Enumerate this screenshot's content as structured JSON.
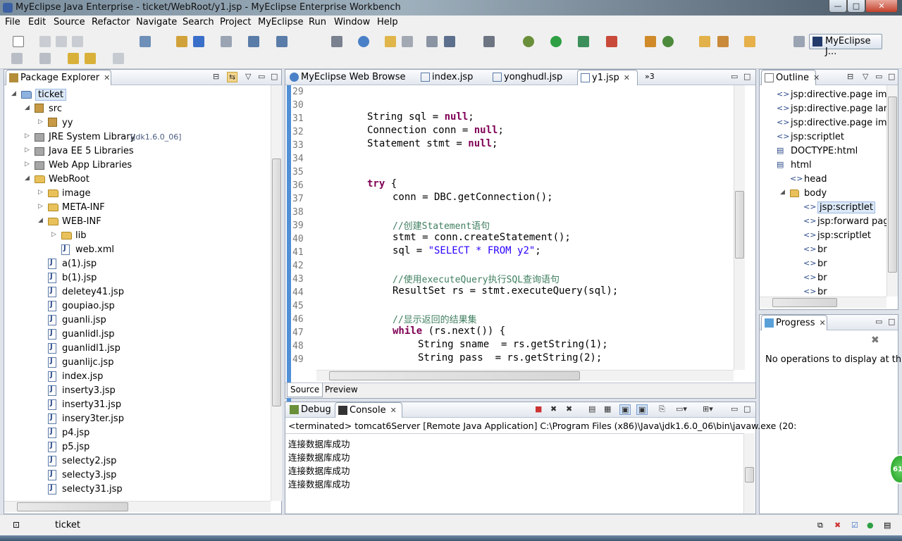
{
  "window": {
    "title": "MyEclipse Java Enterprise - ticket/WebRoot/y1.jsp - MyEclipse Enterprise Workbench",
    "min": "—",
    "max": "□",
    "close": "✕"
  },
  "menu": [
    "File",
    "Edit",
    "Source",
    "Refactor",
    "Navigate",
    "Search",
    "Project",
    "MyEclipse",
    "Run",
    "Window",
    "Help"
  ],
  "perspective": "MyEclipse J...",
  "package_explorer": {
    "title": "Package Explorer",
    "items": [
      {
        "label": "ticket"
      },
      {
        "label": "src"
      },
      {
        "label": "yy"
      },
      {
        "label": "JRE System Library",
        "tag": "[jdk1.6.0_06]"
      },
      {
        "label": "Java EE 5 Libraries"
      },
      {
        "label": "Web App Libraries"
      },
      {
        "label": "WebRoot"
      },
      {
        "label": "image"
      },
      {
        "label": "META-INF"
      },
      {
        "label": "WEB-INF"
      },
      {
        "label": "lib"
      },
      {
        "label": "web.xml"
      },
      {
        "label": "a(1).jsp"
      },
      {
        "label": "b(1).jsp"
      },
      {
        "label": "deletey41.jsp"
      },
      {
        "label": "goupiao.jsp"
      },
      {
        "label": "guanli.jsp"
      },
      {
        "label": "guanlidl.jsp"
      },
      {
        "label": "guanlidl1.jsp"
      },
      {
        "label": "guanlijc.jsp"
      },
      {
        "label": "index.jsp"
      },
      {
        "label": "inserty3.jsp"
      },
      {
        "label": "inserty31.jsp"
      },
      {
        "label": "insery3ter.jsp"
      },
      {
        "label": "p4.jsp"
      },
      {
        "label": "p5.jsp"
      },
      {
        "label": "selecty2.jsp"
      },
      {
        "label": "selecty3.jsp"
      },
      {
        "label": "selecty31.jsp"
      }
    ]
  },
  "editor": {
    "tabs": [
      "MyEclipse Web Browse",
      "index.jsp",
      "yonghudl.jsp",
      "y1.jsp",
      "»3"
    ],
    "line_numbers": [
      "29",
      "30",
      "31",
      "32",
      "33",
      "34",
      "35",
      "36",
      "37",
      "38",
      "39",
      "40",
      "41",
      "42",
      "43",
      "44",
      "45",
      "46",
      "47",
      "48",
      "49"
    ],
    "code": {
      "l31a": "String sql = ",
      "l31k": "null",
      "l31b": ";",
      "l32a": "Connection conn = ",
      "l32k": "null",
      "l32b": ";",
      "l33a": "Statement stmt = ",
      "l33k": "null",
      "l33b": ";",
      "l36k": "try",
      "l36b": " {",
      "l37": "conn = DBC.getConnection();",
      "l39": "//创建Statement语句",
      "l40": "stmt = conn.createStatement();",
      "l41a": "sql = ",
      "l41s": "\"SELECT * FROM y2\"",
      "l41b": ";",
      "l43": "//使用executeQuery执行SQL查询语句",
      "l44": "ResultSet rs = stmt.executeQuery(sql);",
      "l46": "//显示返回的结果集",
      "l47k": "while",
      "l47b": " (rs.next()) {",
      "l48": "String sname  = rs.getString(1);",
      "l49": "String pass  = rs.getString(2);"
    },
    "bottom_tabs": [
      "Source",
      "Preview"
    ]
  },
  "outline": {
    "title": "Outline",
    "items": [
      {
        "label": "jsp:directive.page impo"
      },
      {
        "label": "jsp:directive.page langu"
      },
      {
        "label": "jsp:directive.page impo"
      },
      {
        "label": "jsp:scriptlet"
      },
      {
        "label": "DOCTYPE:html"
      },
      {
        "label": "html"
      },
      {
        "label": "head"
      },
      {
        "label": "body"
      },
      {
        "label": "jsp:scriptlet"
      },
      {
        "label": "jsp:forward page"
      },
      {
        "label": "jsp:scriptlet"
      },
      {
        "label": "br"
      },
      {
        "label": "br"
      },
      {
        "label": "br"
      },
      {
        "label": "br"
      }
    ]
  },
  "progress": {
    "title": "Progress",
    "message": "No operations to display at th"
  },
  "console": {
    "tabs": [
      "Debug",
      "Console"
    ],
    "terminated": "<terminated> tomcat6Server [Remote Java Application] C:\\Program Files (x86)\\Java\\jdk1.6.0_06\\bin\\javaw.exe (20:",
    "lines": [
      "连接数据库成功",
      "连接数据库成功",
      "连接数据库成功",
      "连接数据库成功"
    ]
  },
  "statusbar": {
    "text": "ticket"
  },
  "notification": {
    "badge": "61"
  }
}
